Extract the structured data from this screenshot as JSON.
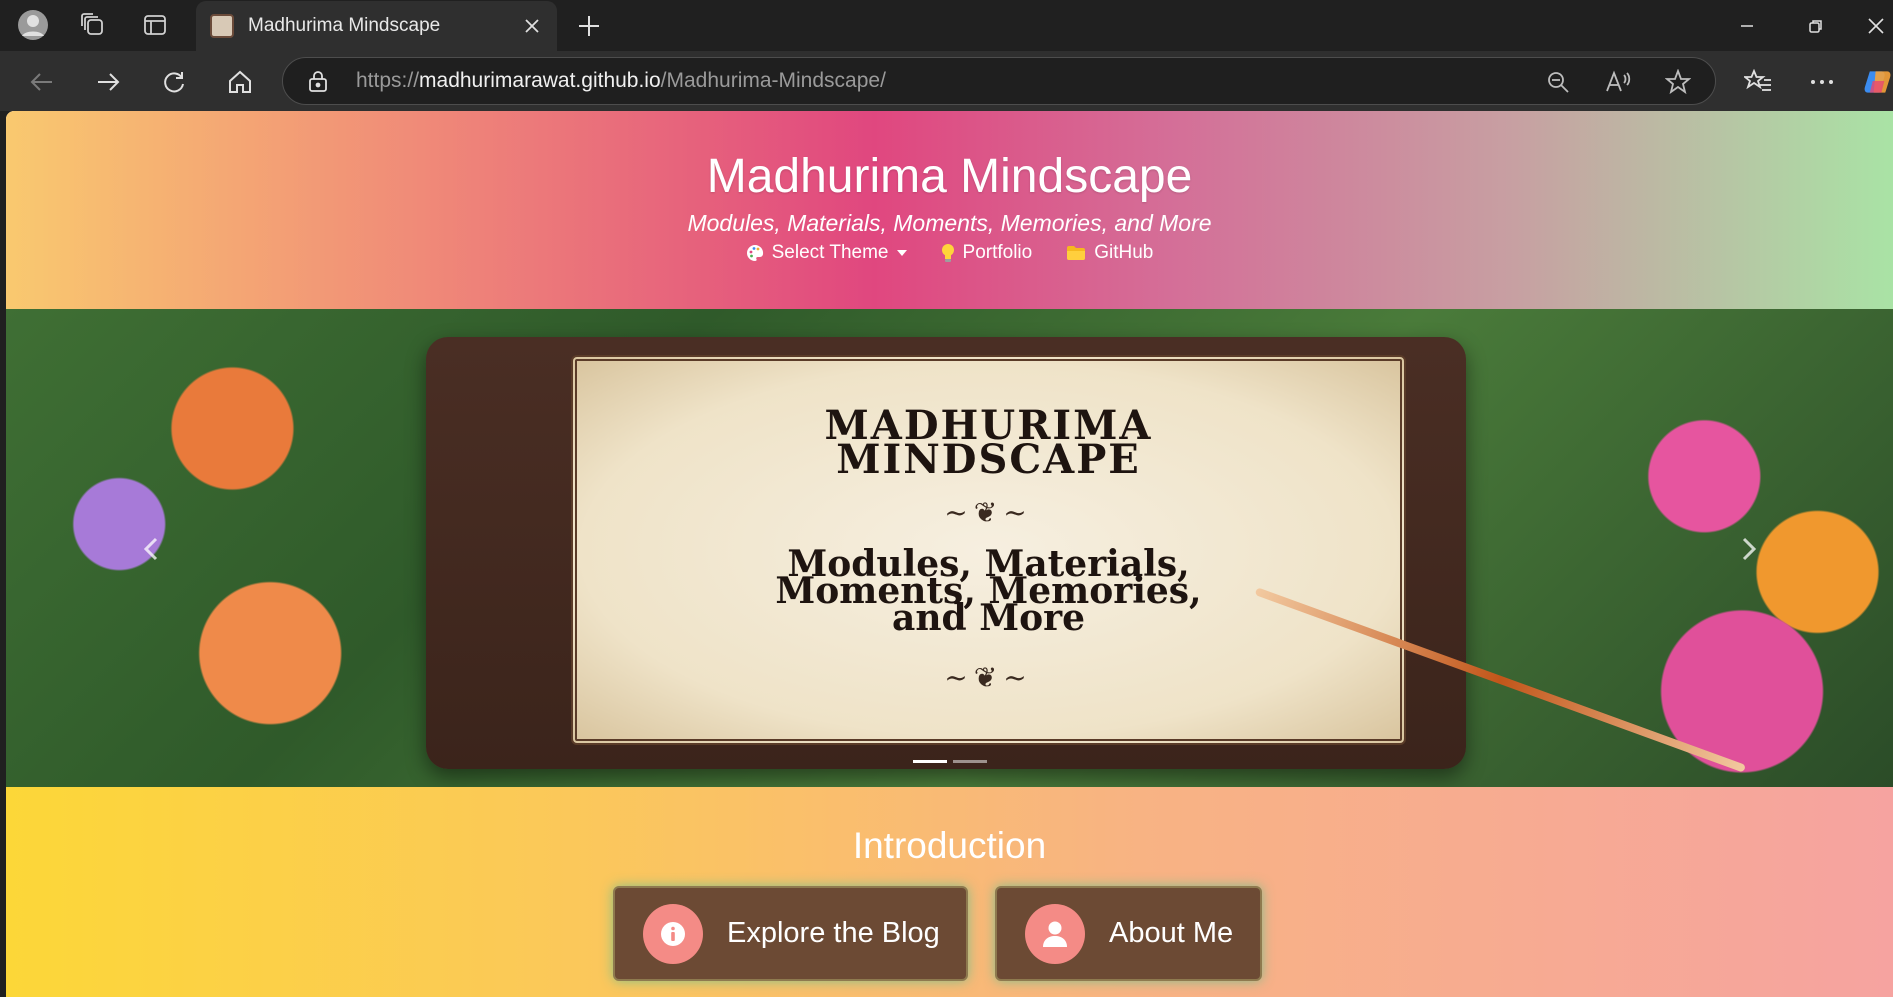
{
  "browser": {
    "tab": {
      "title": "Madhurima Mindscape",
      "favicon": "book-favicon"
    },
    "address_bar": {
      "url_prefix": "https://",
      "url_domain": "madhurimarawat.github.io",
      "url_path": "/Madhurima-Mindscape/"
    },
    "icons": [
      "profile-icon",
      "workspaces-icon",
      "tab-actions-icon",
      "close-icon",
      "new-tab-icon",
      "minimize-icon",
      "restore-icon",
      "close-window-icon",
      "back-icon",
      "forward-icon",
      "refresh-icon",
      "home-icon",
      "lock-icon",
      "zoom-out-icon",
      "read-aloud-icon",
      "favorite-star-icon",
      "favorites-icon",
      "more-icon",
      "copilot-icon"
    ]
  },
  "hero": {
    "title": "Madhurima Mindscape",
    "tagline": "Modules, Materials, Moments, Memories, and More",
    "nav": [
      {
        "label": "Select Theme",
        "icon": "palette-icon"
      },
      {
        "label": "Portfolio",
        "icon": "lightbulb-icon"
      },
      {
        "label": "GitHub",
        "icon": "folder-icon"
      }
    ]
  },
  "carousel": {
    "image_text": {
      "title_line1": "MADHURIMA",
      "title_line2": "MINDSCAPE",
      "sub_line1": "Modules, Materials,",
      "sub_line2": "Moments, Memories,",
      "sub_line3": "and More"
    },
    "slide_count": 2,
    "active_slide": 1
  },
  "intro": {
    "title": "Introduction",
    "buttons": [
      {
        "label": "Explore the Blog",
        "icon": "info-icon"
      },
      {
        "label": "About Me",
        "icon": "user-icon"
      }
    ]
  },
  "colors": {
    "chrome_dark": "#202020",
    "tab_bg": "#2f2f2f",
    "button_bg": "#6c4a34",
    "button_icon_bg": "#f48b86",
    "intro_gradient_start": "#fcd738",
    "intro_gradient_end": "#f6a3a0"
  }
}
